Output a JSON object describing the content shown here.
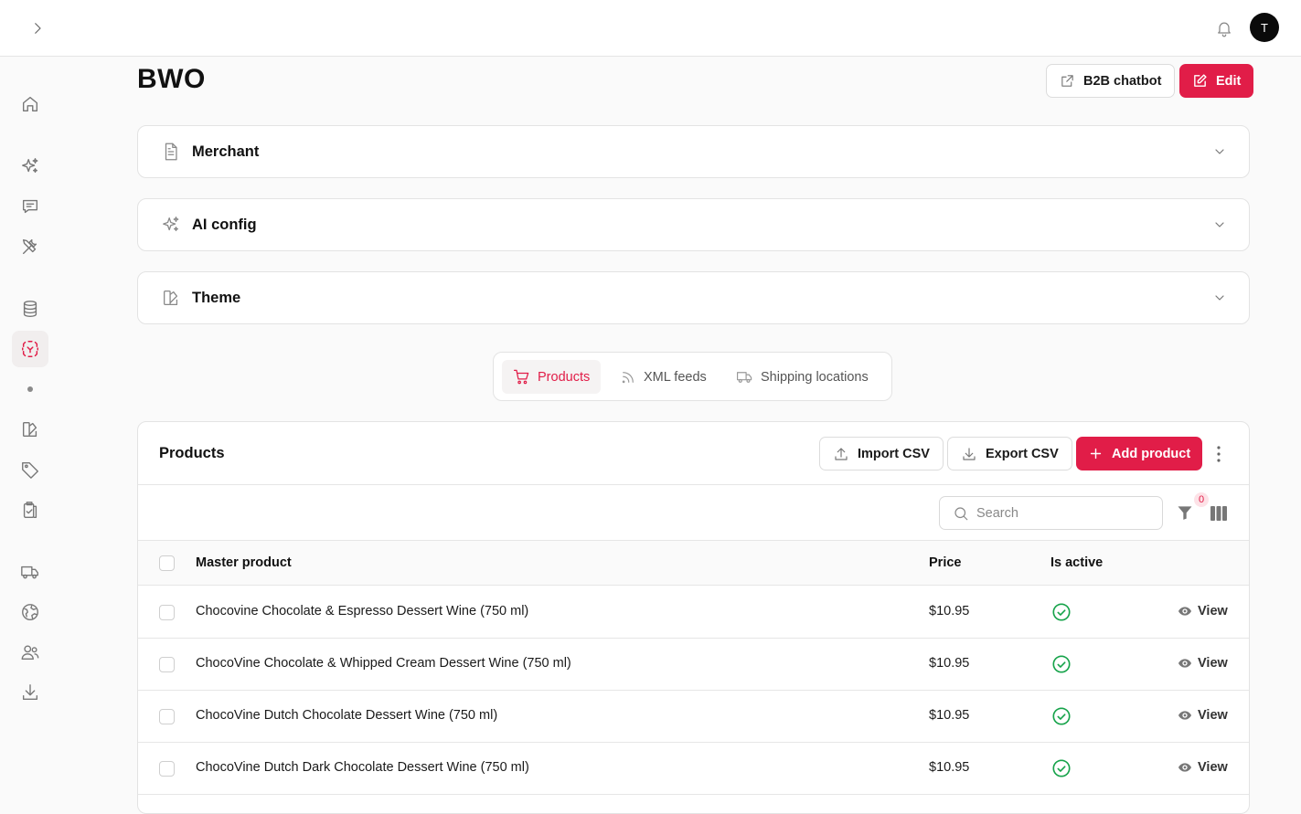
{
  "header": {
    "avatar_initial": "T"
  },
  "page": {
    "title": "BWO",
    "chatbot_label": "B2B chatbot",
    "edit_label": "Edit"
  },
  "sections": [
    {
      "label": "Merchant",
      "icon": "document-icon"
    },
    {
      "label": "AI config",
      "icon": "sparkles-icon"
    },
    {
      "label": "Theme",
      "icon": "palette-icon"
    }
  ],
  "tabs": [
    {
      "label": "Products",
      "icon": "cart-icon",
      "active": true
    },
    {
      "label": "XML feeds",
      "icon": "rss-icon",
      "active": false
    },
    {
      "label": "Shipping locations",
      "icon": "truck-icon",
      "active": false
    }
  ],
  "products": {
    "title": "Products",
    "import_label": "Import CSV",
    "export_label": "Export CSV",
    "add_label": "Add product",
    "search_placeholder": "Search",
    "filter_count": "0",
    "columns": {
      "name": "Master product",
      "price": "Price",
      "active": "Is active"
    },
    "view_label": "View",
    "rows": [
      {
        "name": "Chocovine Chocolate & Espresso Dessert Wine (750 ml)",
        "price": "$10.95",
        "active": true
      },
      {
        "name": "ChocoVine Chocolate & Whipped Cream Dessert Wine (750 ml)",
        "price": "$10.95",
        "active": true
      },
      {
        "name": "ChocoVine Dutch Chocolate Dessert Wine (750 ml)",
        "price": "$10.95",
        "active": true
      },
      {
        "name": "ChocoVine Dutch Dark Chocolate Dessert Wine (750 ml)",
        "price": "$10.95",
        "active": true
      }
    ]
  },
  "colors": {
    "accent": "#e11d48",
    "success": "#16a34a",
    "border": "#e3e3e3"
  }
}
